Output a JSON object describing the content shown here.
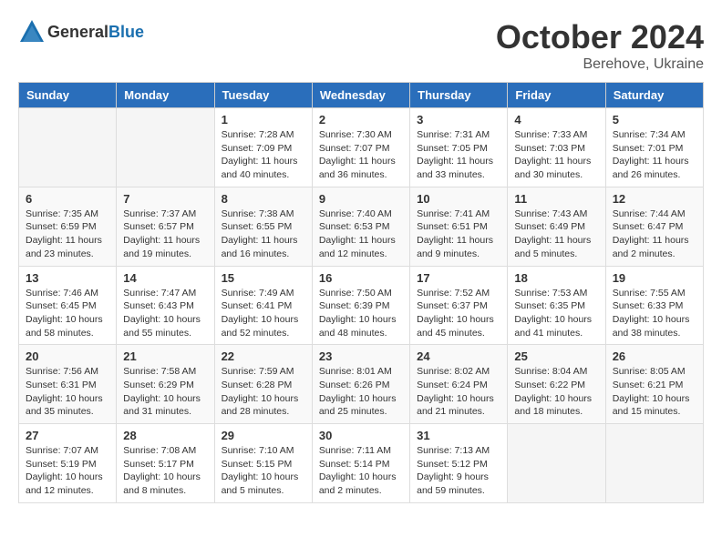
{
  "logo": {
    "text_general": "General",
    "text_blue": "Blue"
  },
  "header": {
    "month": "October 2024",
    "location": "Berehove, Ukraine"
  },
  "weekdays": [
    "Sunday",
    "Monday",
    "Tuesday",
    "Wednesday",
    "Thursday",
    "Friday",
    "Saturday"
  ],
  "weeks": [
    [
      {
        "day": "",
        "sunrise": "",
        "sunset": "",
        "daylight": ""
      },
      {
        "day": "",
        "sunrise": "",
        "sunset": "",
        "daylight": ""
      },
      {
        "day": "1",
        "sunrise": "Sunrise: 7:28 AM",
        "sunset": "Sunset: 7:09 PM",
        "daylight": "Daylight: 11 hours and 40 minutes."
      },
      {
        "day": "2",
        "sunrise": "Sunrise: 7:30 AM",
        "sunset": "Sunset: 7:07 PM",
        "daylight": "Daylight: 11 hours and 36 minutes."
      },
      {
        "day": "3",
        "sunrise": "Sunrise: 7:31 AM",
        "sunset": "Sunset: 7:05 PM",
        "daylight": "Daylight: 11 hours and 33 minutes."
      },
      {
        "day": "4",
        "sunrise": "Sunrise: 7:33 AM",
        "sunset": "Sunset: 7:03 PM",
        "daylight": "Daylight: 11 hours and 30 minutes."
      },
      {
        "day": "5",
        "sunrise": "Sunrise: 7:34 AM",
        "sunset": "Sunset: 7:01 PM",
        "daylight": "Daylight: 11 hours and 26 minutes."
      }
    ],
    [
      {
        "day": "6",
        "sunrise": "Sunrise: 7:35 AM",
        "sunset": "Sunset: 6:59 PM",
        "daylight": "Daylight: 11 hours and 23 minutes."
      },
      {
        "day": "7",
        "sunrise": "Sunrise: 7:37 AM",
        "sunset": "Sunset: 6:57 PM",
        "daylight": "Daylight: 11 hours and 19 minutes."
      },
      {
        "day": "8",
        "sunrise": "Sunrise: 7:38 AM",
        "sunset": "Sunset: 6:55 PM",
        "daylight": "Daylight: 11 hours and 16 minutes."
      },
      {
        "day": "9",
        "sunrise": "Sunrise: 7:40 AM",
        "sunset": "Sunset: 6:53 PM",
        "daylight": "Daylight: 11 hours and 12 minutes."
      },
      {
        "day": "10",
        "sunrise": "Sunrise: 7:41 AM",
        "sunset": "Sunset: 6:51 PM",
        "daylight": "Daylight: 11 hours and 9 minutes."
      },
      {
        "day": "11",
        "sunrise": "Sunrise: 7:43 AM",
        "sunset": "Sunset: 6:49 PM",
        "daylight": "Daylight: 11 hours and 5 minutes."
      },
      {
        "day": "12",
        "sunrise": "Sunrise: 7:44 AM",
        "sunset": "Sunset: 6:47 PM",
        "daylight": "Daylight: 11 hours and 2 minutes."
      }
    ],
    [
      {
        "day": "13",
        "sunrise": "Sunrise: 7:46 AM",
        "sunset": "Sunset: 6:45 PM",
        "daylight": "Daylight: 10 hours and 58 minutes."
      },
      {
        "day": "14",
        "sunrise": "Sunrise: 7:47 AM",
        "sunset": "Sunset: 6:43 PM",
        "daylight": "Daylight: 10 hours and 55 minutes."
      },
      {
        "day": "15",
        "sunrise": "Sunrise: 7:49 AM",
        "sunset": "Sunset: 6:41 PM",
        "daylight": "Daylight: 10 hours and 52 minutes."
      },
      {
        "day": "16",
        "sunrise": "Sunrise: 7:50 AM",
        "sunset": "Sunset: 6:39 PM",
        "daylight": "Daylight: 10 hours and 48 minutes."
      },
      {
        "day": "17",
        "sunrise": "Sunrise: 7:52 AM",
        "sunset": "Sunset: 6:37 PM",
        "daylight": "Daylight: 10 hours and 45 minutes."
      },
      {
        "day": "18",
        "sunrise": "Sunrise: 7:53 AM",
        "sunset": "Sunset: 6:35 PM",
        "daylight": "Daylight: 10 hours and 41 minutes."
      },
      {
        "day": "19",
        "sunrise": "Sunrise: 7:55 AM",
        "sunset": "Sunset: 6:33 PM",
        "daylight": "Daylight: 10 hours and 38 minutes."
      }
    ],
    [
      {
        "day": "20",
        "sunrise": "Sunrise: 7:56 AM",
        "sunset": "Sunset: 6:31 PM",
        "daylight": "Daylight: 10 hours and 35 minutes."
      },
      {
        "day": "21",
        "sunrise": "Sunrise: 7:58 AM",
        "sunset": "Sunset: 6:29 PM",
        "daylight": "Daylight: 10 hours and 31 minutes."
      },
      {
        "day": "22",
        "sunrise": "Sunrise: 7:59 AM",
        "sunset": "Sunset: 6:28 PM",
        "daylight": "Daylight: 10 hours and 28 minutes."
      },
      {
        "day": "23",
        "sunrise": "Sunrise: 8:01 AM",
        "sunset": "Sunset: 6:26 PM",
        "daylight": "Daylight: 10 hours and 25 minutes."
      },
      {
        "day": "24",
        "sunrise": "Sunrise: 8:02 AM",
        "sunset": "Sunset: 6:24 PM",
        "daylight": "Daylight: 10 hours and 21 minutes."
      },
      {
        "day": "25",
        "sunrise": "Sunrise: 8:04 AM",
        "sunset": "Sunset: 6:22 PM",
        "daylight": "Daylight: 10 hours and 18 minutes."
      },
      {
        "day": "26",
        "sunrise": "Sunrise: 8:05 AM",
        "sunset": "Sunset: 6:21 PM",
        "daylight": "Daylight: 10 hours and 15 minutes."
      }
    ],
    [
      {
        "day": "27",
        "sunrise": "Sunrise: 7:07 AM",
        "sunset": "Sunset: 5:19 PM",
        "daylight": "Daylight: 10 hours and 12 minutes."
      },
      {
        "day": "28",
        "sunrise": "Sunrise: 7:08 AM",
        "sunset": "Sunset: 5:17 PM",
        "daylight": "Daylight: 10 hours and 8 minutes."
      },
      {
        "day": "29",
        "sunrise": "Sunrise: 7:10 AM",
        "sunset": "Sunset: 5:15 PM",
        "daylight": "Daylight: 10 hours and 5 minutes."
      },
      {
        "day": "30",
        "sunrise": "Sunrise: 7:11 AM",
        "sunset": "Sunset: 5:14 PM",
        "daylight": "Daylight: 10 hours and 2 minutes."
      },
      {
        "day": "31",
        "sunrise": "Sunrise: 7:13 AM",
        "sunset": "Sunset: 5:12 PM",
        "daylight": "Daylight: 9 hours and 59 minutes."
      },
      {
        "day": "",
        "sunrise": "",
        "sunset": "",
        "daylight": ""
      },
      {
        "day": "",
        "sunrise": "",
        "sunset": "",
        "daylight": ""
      }
    ]
  ]
}
